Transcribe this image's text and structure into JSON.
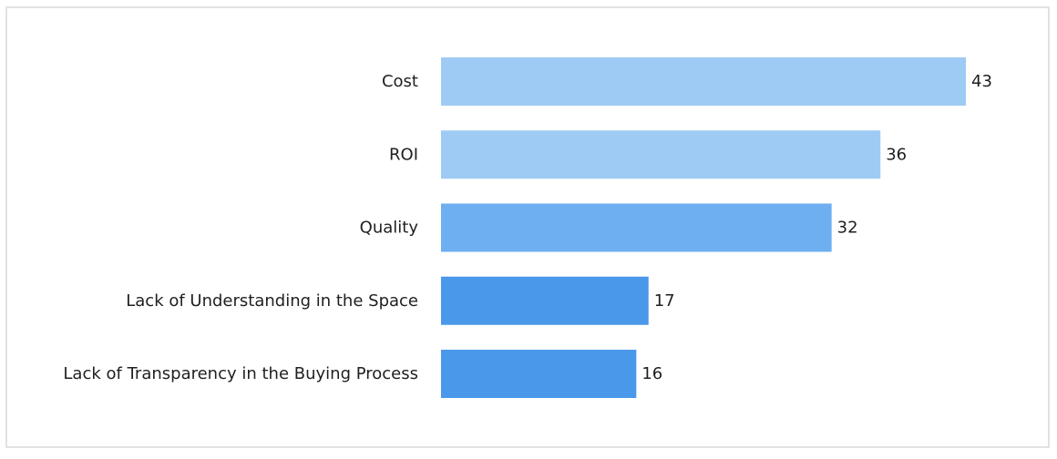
{
  "chart_data": {
    "type": "bar",
    "orientation": "horizontal",
    "title": "",
    "xlabel": "",
    "ylabel": "",
    "categories": [
      "Cost",
      "ROI",
      "Quality",
      "Lack of Understanding in the Space",
      "Lack of Transparency in the Buying Process"
    ],
    "values": [
      43,
      36,
      32,
      17,
      16
    ],
    "bar_colors": [
      "#9ecbf4",
      "#9ecbf4",
      "#6daff0",
      "#4a98ea",
      "#4a98ea"
    ],
    "xlim": [
      0,
      43
    ],
    "grid": false,
    "legend": "none"
  }
}
